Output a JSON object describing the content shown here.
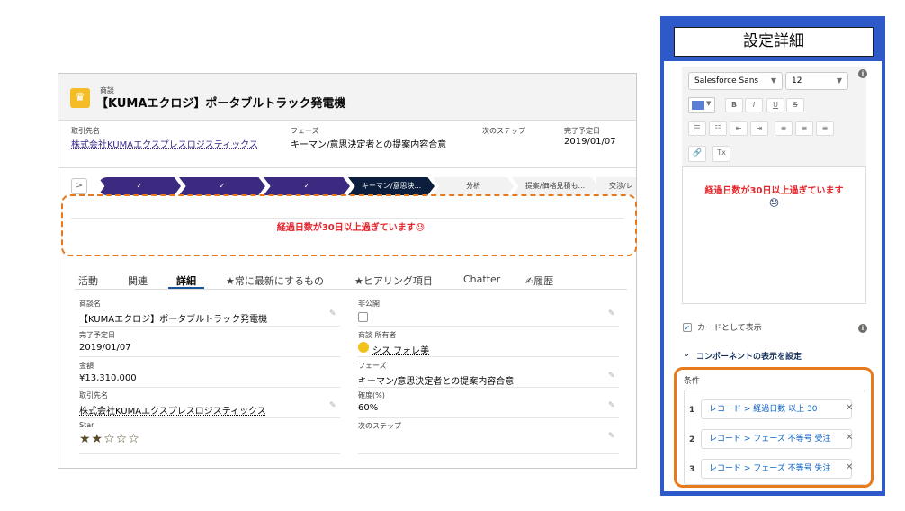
{
  "record": {
    "object_label": "商談",
    "title": "【KUMAエクロジ】ポータブルトラック発電機",
    "highlights": [
      {
        "label": "取引先名",
        "value": "株式会社KUMAエクスプレスロジスティックス"
      },
      {
        "label": "フェーズ",
        "value": "キーマン/意思決定者との提案内容合意"
      },
      {
        "label": "次のステップ",
        "value": ""
      },
      {
        "label": "完了予定日",
        "value": "2019/01/07"
      }
    ]
  },
  "path": {
    "toggle": ">",
    "steps": [
      "✓",
      "✓",
      "✓",
      "キーマン/意思決...",
      "分析",
      "提案/価格見積も...",
      "交渉/レ"
    ]
  },
  "banner": {
    "text": "経過日数が30日以上過ぎています😓"
  },
  "tabs": [
    "活動",
    "関連",
    "詳細",
    "★常に最新にするもの",
    "★ヒアリング項目",
    "Chatter",
    "✍履歴"
  ],
  "fields": {
    "left": [
      {
        "label": "商談名",
        "value": "【KUMAエクロジ】ポータブルトラック発電機"
      },
      {
        "label": "完了予定日",
        "value": "2019/01/07"
      },
      {
        "label": "金額",
        "value": "¥13,310,000"
      },
      {
        "label": "取引先名",
        "value": "株式会社KUMAエクスプレスロジスティックス"
      },
      {
        "label": "Star",
        "value": "★★☆☆☆"
      }
    ],
    "right": [
      {
        "label": "非公開",
        "value": ""
      },
      {
        "label": "商談 所有者",
        "value": "シス フォレ美"
      },
      {
        "label": "フェーズ",
        "value": "キーマン/意思決定者との提案内容合意"
      },
      {
        "label": "確度(%)",
        "value": "60%"
      },
      {
        "label": "次のステップ",
        "value": ""
      }
    ]
  },
  "panel": {
    "title": "設定詳細",
    "font_family_value": "Salesforce Sans",
    "font_size_value": "12",
    "format_buttons": [
      "B",
      "I",
      "U",
      "S"
    ],
    "list_buttons": [
      "☰",
      "☷",
      "⇤",
      "⇥",
      "≡",
      "≡",
      "≡"
    ],
    "link_button": "🔗",
    "clear_button": "Tx",
    "preview_text": "経過日数が30日以上過ぎています",
    "preview_emoji": "😓",
    "card_checkbox_label": "カードとして表示",
    "visibility_section": "コンポーネントの表示を設定",
    "conditions_label": "条件",
    "filters": [
      {
        "num": "1",
        "text": "レコード > 経過日数 以上 30"
      },
      {
        "num": "2",
        "text": "レコード > フェーズ 不等号 受注"
      },
      {
        "num": "3",
        "text": "レコード > フェーズ 不等号 失注"
      }
    ]
  },
  "colors": {
    "path_done": "#3b2a7f",
    "path_current": "#0b1e3d",
    "highlight_orange": "#e87a1e",
    "panel_blue": "#2d59c9",
    "alert_red": "#e3242b"
  }
}
